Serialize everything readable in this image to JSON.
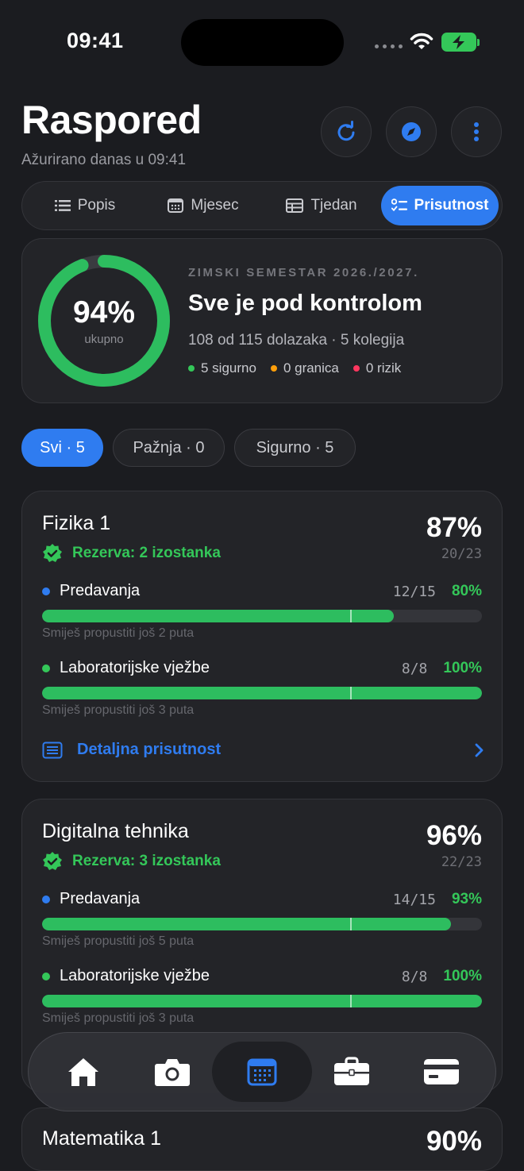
{
  "status_bar": {
    "time": "09:41"
  },
  "header": {
    "title": "Raspored",
    "subtitle": "Ažurirano danas u 09:41",
    "actions": [
      "refresh-icon",
      "compass-icon",
      "more-vertical-icon"
    ]
  },
  "tabs": [
    {
      "label": "Popis",
      "icon": "list-icon",
      "active": false
    },
    {
      "label": "Mjesec",
      "icon": "calendar-month-icon",
      "active": false
    },
    {
      "label": "Tjedan",
      "icon": "table-week-icon",
      "active": false
    },
    {
      "label": "Prisutnost",
      "icon": "checklist-icon",
      "active": true
    }
  ],
  "summary": {
    "percent_label": "94%",
    "percent_value": 94,
    "caption": "ukupno",
    "semester": "ZIMSKI SEMESTAR 2026./2027.",
    "title": "Sve je pod kontrolom",
    "detail": "108 od 115 dolazaka · 5 kolegija",
    "legend": [
      {
        "label": "5 sigurno",
        "color": "#34c759"
      },
      {
        "label": "0 granica",
        "color": "#ff9f0a"
      },
      {
        "label": "0 rizik",
        "color": "#ff375f"
      }
    ]
  },
  "filters": [
    {
      "label": "Svi · 5",
      "active": true
    },
    {
      "label": "Pažnja · 0",
      "active": false
    },
    {
      "label": "Sigurno · 5",
      "active": false
    }
  ],
  "courses": [
    {
      "name": "Fizika 1",
      "percent": "87%",
      "fraction": "20/23",
      "reserve": "Rezerva: 2 izostanka",
      "rows": [
        {
          "label": "Predavanja",
          "dot": "#2f7cf0",
          "count": "12/15",
          "percent": "80%",
          "fill": 0.8,
          "threshold": 0.7,
          "hint": "Smiješ propustiti još 2 puta"
        },
        {
          "label": "Laboratorijske vježbe",
          "dot": "#34c759",
          "count": "8/8",
          "percent": "100%",
          "fill": 1.0,
          "threshold": 0.7,
          "hint": "Smiješ propustiti još 3 puta"
        }
      ],
      "detail_link": "Detaljna prisutnost"
    },
    {
      "name": "Digitalna tehnika",
      "percent": "96%",
      "fraction": "22/23",
      "reserve": "Rezerva: 3 izostanka",
      "rows": [
        {
          "label": "Predavanja",
          "dot": "#2f7cf0",
          "count": "14/15",
          "percent": "93%",
          "fill": 0.93,
          "threshold": 0.7,
          "hint": "Smiješ propustiti još 5 puta"
        },
        {
          "label": "Laboratorijske vježbe",
          "dot": "#34c759",
          "count": "8/8",
          "percent": "100%",
          "fill": 1.0,
          "threshold": 0.7,
          "hint": "Smiješ propustiti još 3 puta"
        }
      ]
    },
    {
      "name": "Matematika 1",
      "percent": "90%"
    }
  ],
  "tabbar": [
    {
      "icon": "home-icon",
      "active": false
    },
    {
      "icon": "camera-icon",
      "active": false
    },
    {
      "icon": "calendar-icon",
      "active": true
    },
    {
      "icon": "briefcase-icon",
      "active": false
    },
    {
      "icon": "credit-card-icon",
      "active": false
    }
  ],
  "colors": {
    "accent": "#2f7cf0",
    "success": "#34c759",
    "warning": "#ff9f0a",
    "danger": "#ff375f",
    "background": "#1b1c20",
    "card": "#232428"
  }
}
